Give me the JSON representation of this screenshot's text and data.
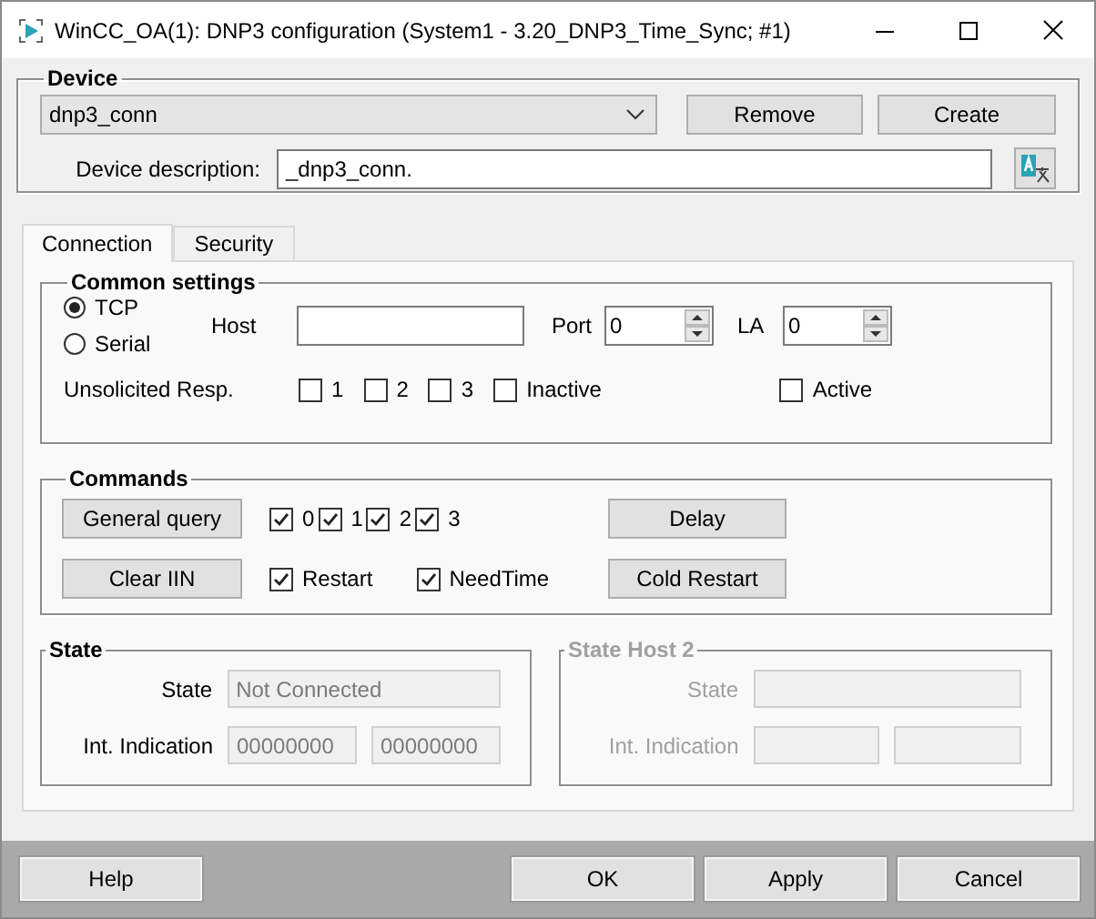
{
  "window": {
    "title": "WinCC_OA(1): DNP3 configuration (System1 - 3.20_DNP3_Time_Sync; #1)"
  },
  "device": {
    "title": "Device",
    "connection": "dnp3_conn",
    "buttons": [
      "Remove",
      "Create"
    ],
    "description_label": "Device description:",
    "description": "_dnp3_conn."
  },
  "tabs": [
    {
      "label": "Connection",
      "selected": true
    },
    {
      "label": "Security",
      "selected": false
    }
  ],
  "common_settings": {
    "title": "Common settings",
    "protocols": [
      {
        "label": "TCP",
        "selected": true
      },
      {
        "label": "Serial",
        "selected": false
      }
    ],
    "host_label": "Host",
    "port_label": "Port",
    "port": "0",
    "la_label": "LA",
    "la": "0",
    "unsolicited_label": "Unsolicited Resp.",
    "unsolicited": [
      {
        "label": "1",
        "checked": false
      },
      {
        "label": "2",
        "checked": false
      },
      {
        "label": "3",
        "checked": false
      },
      {
        "label": "Inactive",
        "checked": false
      },
      {
        "label": "Active",
        "checked": false
      }
    ]
  },
  "commands": {
    "title": "Commands",
    "rows": [
      {
        "left": "General query",
        "checks": [
          {
            "label": "0",
            "checked": true
          },
          {
            "label": "1",
            "checked": true
          },
          {
            "label": "2",
            "checked": true
          },
          {
            "label": "3",
            "checked": true
          }
        ],
        "right": "Delay"
      },
      {
        "left": "Clear IIN",
        "checks": [
          {
            "label": "Restart",
            "checked": true
          },
          {
            "label": "NeedTime",
            "checked": true
          }
        ],
        "right": "Cold Restart"
      }
    ]
  },
  "state_panels": [
    {
      "title": "State",
      "disabled": false,
      "state_label": "State",
      "state": "Not Connected",
      "indication_label": "Int. Indication",
      "indication": [
        "00000000",
        "00000000"
      ]
    },
    {
      "title": "State Host 2",
      "disabled": true,
      "state_label": "State",
      "indication_label": "Int. Indication"
    }
  ],
  "footer": {
    "left": [
      "Help"
    ],
    "right": [
      "OK",
      "Apply",
      "Cancel"
    ]
  }
}
